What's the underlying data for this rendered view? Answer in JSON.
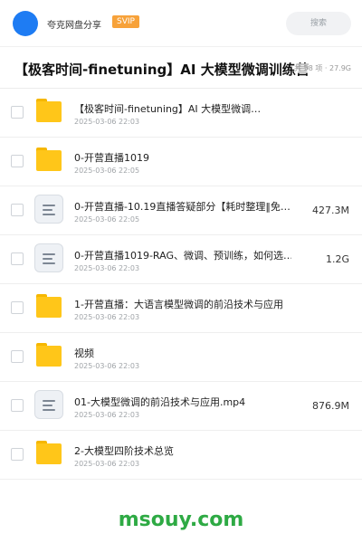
{
  "header": {
    "app_name": "夸克网盘分享",
    "badge": "SVIP",
    "search_placeholder": "搜索",
    "avatar_color": "#1e7cf3"
  },
  "folder": {
    "title": "【极客时间-finetuning】AI 大模型微调训练营",
    "meta": "共 58 项 · 27.9G"
  },
  "items": [
    {
      "type": "folder",
      "name": "【极客时间-finetuning】AI 大模型微调…",
      "date": "2025-03-06 22:03",
      "size": ""
    },
    {
      "type": "folder",
      "name": "0-开营直播1019",
      "date": "2025-03-06 22:05",
      "size": ""
    },
    {
      "type": "file",
      "name": "0-开营直播-10.19直播答疑部分【耗时整理‖免…",
      "date": "2025-03-06 22:05",
      "size": "427.3M"
    },
    {
      "type": "file",
      "name": "0-开营直播1019-RAG、微调、预训练，如何选…",
      "date": "2025-03-06 22:03",
      "size": "1.2G"
    },
    {
      "type": "folder",
      "name": "1-开营直播：大语言模型微调的前沿技术与应用",
      "date": "2025-03-06 22:03",
      "size": ""
    },
    {
      "type": "folder",
      "name": "视频",
      "date": "2025-03-06 22:03",
      "size": ""
    },
    {
      "type": "file",
      "name": "01-大模型微调的前沿技术与应用.mp4",
      "date": "2025-03-06 22:03",
      "size": "876.9M"
    },
    {
      "type": "folder",
      "name": "2-大模型四阶技术总览",
      "date": "2025-03-06 22:03",
      "size": ""
    }
  ],
  "watermark": "msouy.com",
  "colors": {
    "folder": "#ffc619",
    "badge": "#f7a23a",
    "watermark": "#2eaa44"
  }
}
